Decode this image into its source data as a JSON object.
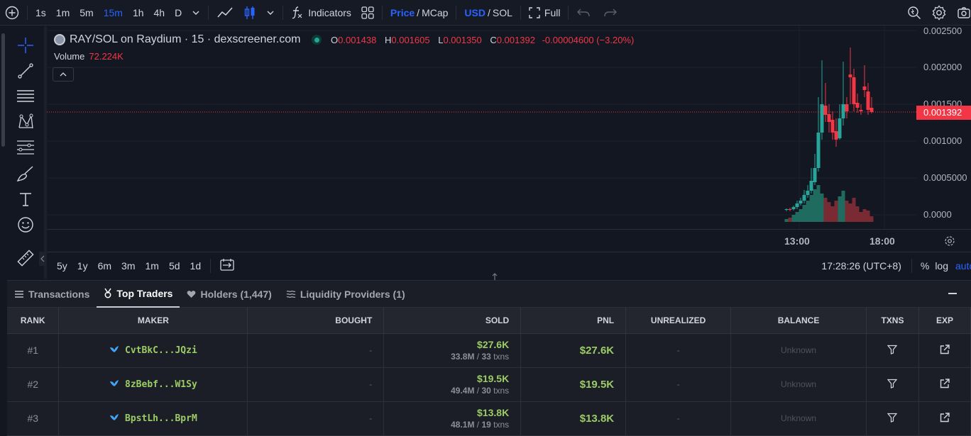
{
  "toolbar": {
    "intervals": [
      "1s",
      "1m",
      "5m",
      "15m",
      "1h",
      "4h",
      "D"
    ],
    "active_interval": "15m",
    "indicators_label": "Indicators",
    "price_label": "Price",
    "mcap_label": "MCap",
    "usd_label": "USD",
    "sol_label": "SOL",
    "full_label": "Full",
    "slash": "/"
  },
  "legend": {
    "title": "RAY/SOL on Raydium · 15 · dexscreener.com",
    "o_key": "O",
    "o_val": "0.001438",
    "h_key": "H",
    "h_val": "0.001605",
    "l_key": "L",
    "l_val": "0.001350",
    "c_key": "C",
    "c_val": "0.001392",
    "change": "-0.00004600 (−3.20%)",
    "volume_label": "Volume",
    "volume_val": "72.224K"
  },
  "price_axis": {
    "ticks": [
      "0.002500",
      "0.002000",
      "0.001500",
      "0.001000",
      "0.0005000",
      "0.0000"
    ],
    "current": "0.001392"
  },
  "time_axis": {
    "ticks": [
      "13:00",
      "18:00"
    ]
  },
  "range_bar": {
    "ranges": [
      "5y",
      "1y",
      "6m",
      "3m",
      "1m",
      "5d",
      "1d"
    ],
    "clock": "17:28:26 (UTC+8)",
    "percent": "%",
    "log": "log",
    "auto": "auto"
  },
  "tabs": {
    "transactions": "Transactions",
    "top_traders": "Top Traders",
    "holders": "Holders (1,447)",
    "liquidity": "Liquidity Providers (1)"
  },
  "table": {
    "headers": {
      "rank": "RANK",
      "maker": "MAKER",
      "bought": "BOUGHT",
      "sold": "SOLD",
      "pnl": "PNL",
      "unrealized": "UNREALIZED",
      "balance": "BALANCE",
      "txns": "TXNS",
      "exp": "EXP"
    },
    "rows": [
      {
        "rank": "#1",
        "maker": "CvtBkC...JQzi",
        "bought": "-",
        "sold_amt": "$27.6K",
        "sold_tokens": "33.8M",
        "sold_txns": "33",
        "txns_word": "txns",
        "pnl": "$27.6K",
        "unrealized": "-",
        "balance": "Unknown"
      },
      {
        "rank": "#2",
        "maker": "8zBebf...W1Sy",
        "bought": "-",
        "sold_amt": "$19.5K",
        "sold_tokens": "49.4M",
        "sold_txns": "30",
        "txns_word": "txns",
        "pnl": "$19.5K",
        "unrealized": "-",
        "balance": "Unknown"
      },
      {
        "rank": "#3",
        "maker": "BpstLh...BprM",
        "bought": "-",
        "sold_amt": "$13.8K",
        "sold_tokens": "48.1M",
        "sold_txns": "19",
        "txns_word": "txns",
        "pnl": "$13.8K",
        "unrealized": "-",
        "balance": "Unknown"
      }
    ]
  },
  "colors": {
    "up": "#26a69a",
    "down": "#f23645",
    "accent": "#2962ff",
    "profit": "#9ccc65"
  }
}
